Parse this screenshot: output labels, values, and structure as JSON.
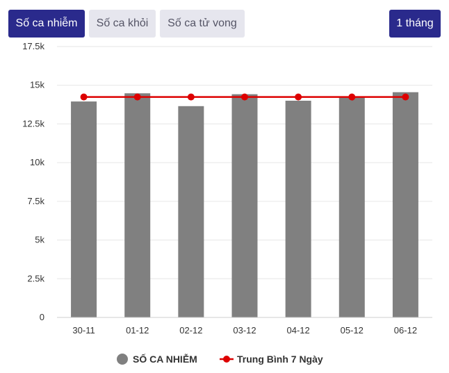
{
  "tabs": [
    {
      "label": "Số ca nhiễm",
      "active": true
    },
    {
      "label": "Số ca khỏi",
      "active": false
    },
    {
      "label": "Số ca tử vong",
      "active": false
    }
  ],
  "range_button": {
    "label": "1 tháng"
  },
  "colors": {
    "accent": "#2a2a8c",
    "bar": "#808080",
    "line": "#dd0000",
    "inactive_tab": "#e6e6ee"
  },
  "chart_data": {
    "type": "bar",
    "categories": [
      "30-11",
      "01-12",
      "02-12",
      "03-12",
      "04-12",
      "05-12",
      "06-12"
    ],
    "series": [
      {
        "name": "SỐ CA NHIỄM",
        "type": "bar",
        "values": [
          13950,
          14480,
          13650,
          14420,
          14000,
          14250,
          14550
        ]
      },
      {
        "name": "Trung Bình 7 Ngày",
        "type": "line",
        "values": [
          14240,
          14240,
          14240,
          14240,
          14240,
          14240,
          14240
        ]
      }
    ],
    "yticks": [
      "0",
      "2.5k",
      "5k",
      "7.5k",
      "10k",
      "12.5k",
      "15k",
      "17.5k"
    ],
    "ylim": [
      0,
      17500
    ],
    "grid": true,
    "legend_position": "bottom"
  }
}
